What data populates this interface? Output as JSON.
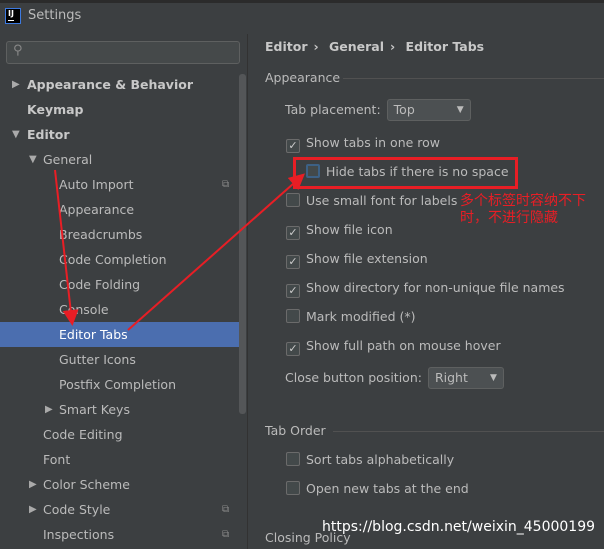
{
  "window": {
    "title": "Settings",
    "logo": "IJ"
  },
  "search": {
    "placeholder": "",
    "icon": "search-icon"
  },
  "tree": [
    {
      "label": "Appearance & Behavior",
      "level": 0,
      "arrow": "right",
      "bold": true
    },
    {
      "label": "Keymap",
      "level": 0,
      "bold": true
    },
    {
      "label": "Editor",
      "level": 0,
      "arrow": "down",
      "bold": true
    },
    {
      "label": "General",
      "level": 1,
      "arrow": "down"
    },
    {
      "label": "Auto Import",
      "level": 2,
      "copy": true
    },
    {
      "label": "Appearance",
      "level": 2
    },
    {
      "label": "Breadcrumbs",
      "level": 2
    },
    {
      "label": "Code Completion",
      "level": 2
    },
    {
      "label": "Code Folding",
      "level": 2
    },
    {
      "label": "Console",
      "level": 2
    },
    {
      "label": "Editor Tabs",
      "level": 2,
      "selected": true
    },
    {
      "label": "Gutter Icons",
      "level": 2
    },
    {
      "label": "Postfix Completion",
      "level": 2
    },
    {
      "label": "Smart Keys",
      "level": 2,
      "arrow": "right"
    },
    {
      "label": "Code Editing",
      "level": 1
    },
    {
      "label": "Font",
      "level": 1
    },
    {
      "label": "Color Scheme",
      "level": 1,
      "arrow": "right"
    },
    {
      "label": "Code Style",
      "level": 1,
      "arrow": "right",
      "copy": true
    },
    {
      "label": "Inspections",
      "level": 1,
      "copy": true
    }
  ],
  "breadcrumb": [
    "Editor",
    "General",
    "Editor Tabs"
  ],
  "sections": {
    "appearance": "Appearance",
    "tab_order": "Tab Order",
    "closing": "Closing Policy"
  },
  "tab_placement": {
    "label": "Tab placement:",
    "value": "Top"
  },
  "options": [
    {
      "label": "Show tabs in one row",
      "checked": true,
      "indent": 0
    },
    {
      "label": "Hide tabs if there is no space",
      "checked": false,
      "indent": 1,
      "focused": true
    },
    {
      "label": "Use small font for labels",
      "checked": false,
      "indent": 0
    },
    {
      "label": "Show file icon",
      "checked": true,
      "indent": 0
    },
    {
      "label": "Show file extension",
      "checked": true,
      "indent": 0
    },
    {
      "label": "Show directory for non-unique file names",
      "checked": true,
      "indent": 0
    },
    {
      "label": "Mark modified (*)",
      "checked": false,
      "indent": 0
    },
    {
      "label": "Show full path on mouse hover",
      "checked": true,
      "indent": 0
    }
  ],
  "close_button": {
    "label": "Close button position:",
    "value": "Right"
  },
  "tab_order_options": [
    {
      "label": "Sort tabs alphabetically",
      "checked": false
    },
    {
      "label": "Open new tabs at the end",
      "checked": false
    }
  ],
  "annotation": {
    "note": "多个标签时容纳不下时，不进行隐藏",
    "color": "#e81e25"
  },
  "watermark": "https://blog.csdn.net/weixin_45000199",
  "colors": {
    "selection": "#4b6eaf",
    "background": "#3c3f41"
  }
}
